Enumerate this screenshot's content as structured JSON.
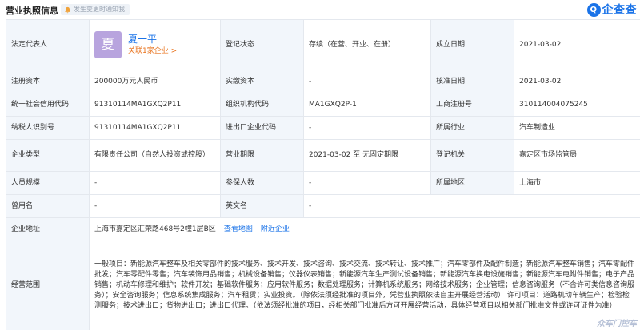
{
  "header": {
    "title": "营业执照信息",
    "notify_label": "发生变更时通知我",
    "logo_text": "企查查",
    "logo_mark": "Q"
  },
  "rep": {
    "label": "法定代表人",
    "avatar_char": "夏",
    "name": "夏一平",
    "related": "关联1家企业 >"
  },
  "fields": {
    "reg_status_label": "登记状态",
    "reg_status": "存续（在营、开业、在册）",
    "founded_label": "成立日期",
    "founded": "2021-03-02",
    "reg_capital_label": "注册资本",
    "reg_capital": "200000万元人民币",
    "paid_capital_label": "实缴资本",
    "paid_capital": "-",
    "approval_label": "核准日期",
    "approval": "2021-03-02",
    "credit_code_label": "统一社会信用代码",
    "credit_code": "91310114MA1GXQ2P11",
    "org_code_label": "组织机构代码",
    "org_code": "MA1GXQ2P-1",
    "biz_reg_label": "工商注册号",
    "biz_reg": "310114004075245",
    "taxpayer_label": "纳税人识别号",
    "taxpayer": "91310114MA1GXQ2P11",
    "impexp_label": "进出口企业代码",
    "impexp": "-",
    "industry_label": "所属行业",
    "industry": "汽车制造业",
    "type_label": "企业类型",
    "type": "有限责任公司（自然人投资或控股）",
    "term_label": "营业期限",
    "term": "2021-03-02 至 无固定期限",
    "authority_label": "登记机关",
    "authority": "嘉定区市场监管局",
    "staff_label": "人员规模",
    "staff": "-",
    "insured_label": "参保人数",
    "insured": "-",
    "region_label": "所属地区",
    "region": "上海市",
    "former_label": "曾用名",
    "former": "-",
    "english_label": "英文名",
    "english": "-",
    "address_label": "企业地址",
    "address": "上海市嘉定区汇荣路468号2幢1层B区",
    "map_link": "查看地图",
    "nearby_link": "附近企业",
    "scope_label": "经营范围",
    "scope": "一般项目：新能源汽车整车及相关零部件的技术服务、技术开发、技术咨询、技术交流、技术转让、技术推广；汽车零部件及配件制造；新能源汽车整车销售；汽车零配件批发；汽车零配件零售；汽车装饰用品销售；机械设备销售；仪器仪表销售；新能源汽车生产测试设备销售；新能源汽车换电设施销售；新能源汽车电附件销售；电子产品销售；机动车修理和维护；软件开发；基础软件服务；应用软件服务；数据处理服务；计算机系统服务；网络技术服务；企业管理；信息咨询服务（不含许可类信息咨询服务）；安全咨询服务；信息系统集成服务；汽车租赁；实业投资。（除依法须经批准的项目外，凭营业执照依法自主开展经营活动） 许可项目：道路机动车辆生产；检验检测服务；技术进出口；货物进出口；进出口代理。（依法须经批准的项目，经相关部门批准后方可开展经营活动，具体经营项目以相关部门批准文件或许可证件为准）"
  },
  "watermark": "众车门控车",
  "colors": {
    "accent": "#1a73e8",
    "orange": "#e8711a",
    "key_bg": "#f2f6fb",
    "border": "#e4e8ee",
    "avatar": "#b8a4de"
  }
}
